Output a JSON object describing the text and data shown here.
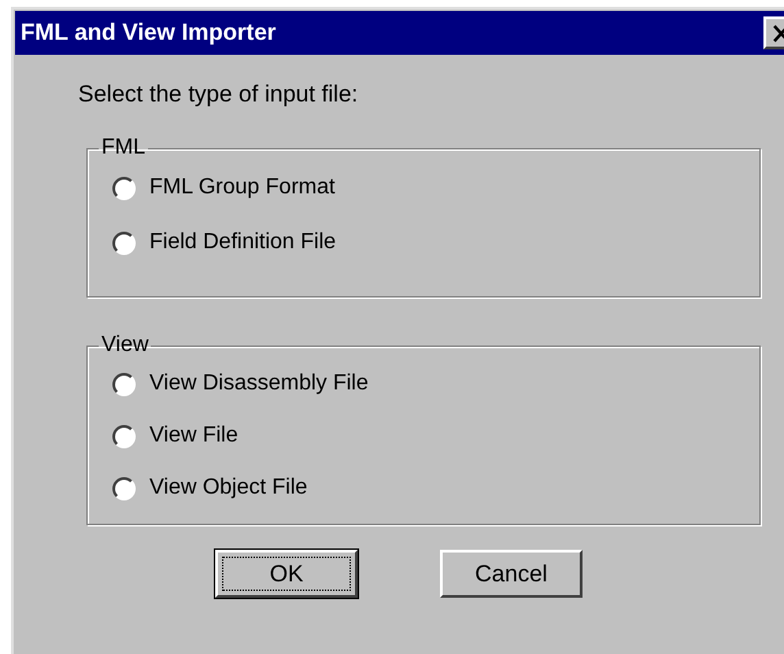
{
  "window": {
    "title": "FML and View Importer"
  },
  "prompt": "Select the type of input file:",
  "groups": [
    {
      "label": "FML",
      "options": [
        {
          "label": "FML Group Format",
          "selected": false
        },
        {
          "label": "Field Definition File",
          "selected": false
        }
      ]
    },
    {
      "label": "View",
      "options": [
        {
          "label": "View Disassembly File",
          "selected": false
        },
        {
          "label": "View File",
          "selected": false
        },
        {
          "label": "View Object File",
          "selected": false
        }
      ]
    }
  ],
  "buttons": [
    {
      "label": "OK",
      "default": true
    },
    {
      "label": "Cancel",
      "default": false
    }
  ]
}
